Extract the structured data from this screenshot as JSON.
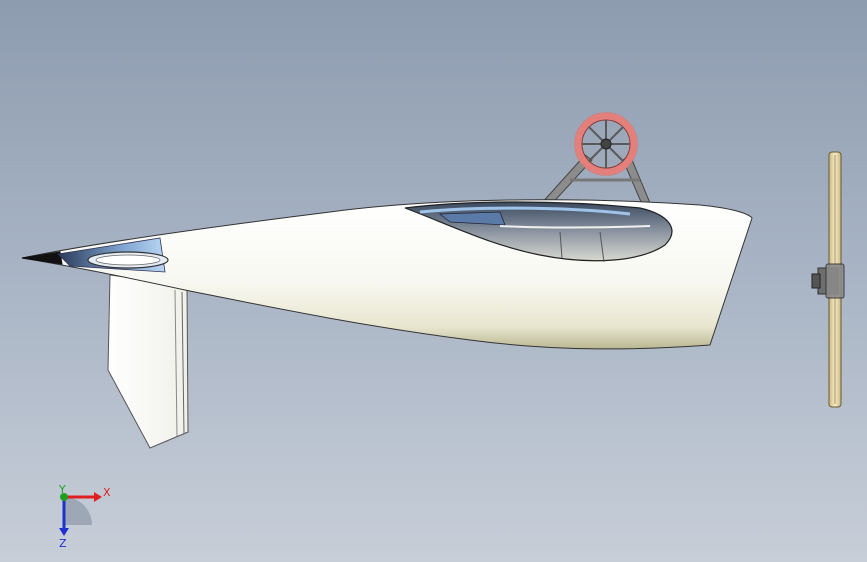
{
  "viewport": {
    "background_top": "#8e9cb0",
    "background_bottom": "#c7ced8"
  },
  "model": {
    "parts": [
      "hull-body",
      "bow-tip",
      "bow-hatch",
      "skeg-fin",
      "cockpit-opening",
      "fan-guard-wheel",
      "fan-support-struts",
      "propeller",
      "propeller-hub"
    ],
    "colors": {
      "hull": "#ffffff",
      "hull_shade": "#c9c7a4",
      "fan_ring": "#e3807c",
      "propeller": "#e8d9a8",
      "hatch_blue": "#9fc3e8",
      "struts": "#8c8c8c"
    }
  },
  "triad": {
    "x_label": "X",
    "y_label": "Y",
    "z_label": "Z",
    "x_color": "#e02020",
    "y_color": "#20a020",
    "z_color": "#2030d0"
  }
}
